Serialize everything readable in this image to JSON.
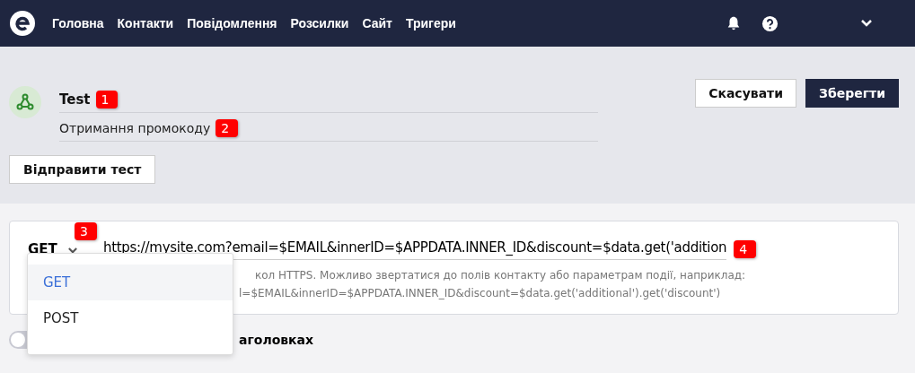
{
  "nav": {
    "items": [
      {
        "label": "Головна"
      },
      {
        "label": "Контакти"
      },
      {
        "label": "Повідомлення"
      },
      {
        "label": "Розсилки"
      },
      {
        "label": "Сайт"
      },
      {
        "label": "Тригери"
      }
    ]
  },
  "header": {
    "title": "Test",
    "description": "Отримання промокоду",
    "cancel_button": "Скасувати",
    "save_button": "Зберегти",
    "test_button": "Відправити тест"
  },
  "request": {
    "method": "GET",
    "url": "https://mysite.com?email=$EMAIL&innerID=$APPDATA.INNER_ID&discount=$data.get('addition",
    "hint_lines": [
      "кол HTTPS. Можливо звертатися до полів контакту або параметрам події, наприклад:",
      "l=$EMAIL&innerID=$APPDATA.INNER_ID&discount=$data.get('additional').get('discount')"
    ]
  },
  "method_menu": {
    "options": [
      {
        "label": "GET",
        "selected": true
      },
      {
        "label": "POST",
        "selected": false
      }
    ]
  },
  "toggle": {
    "label": "аголовках",
    "on": false
  },
  "annotations": [
    "1",
    "2",
    "3",
    "4"
  ]
}
